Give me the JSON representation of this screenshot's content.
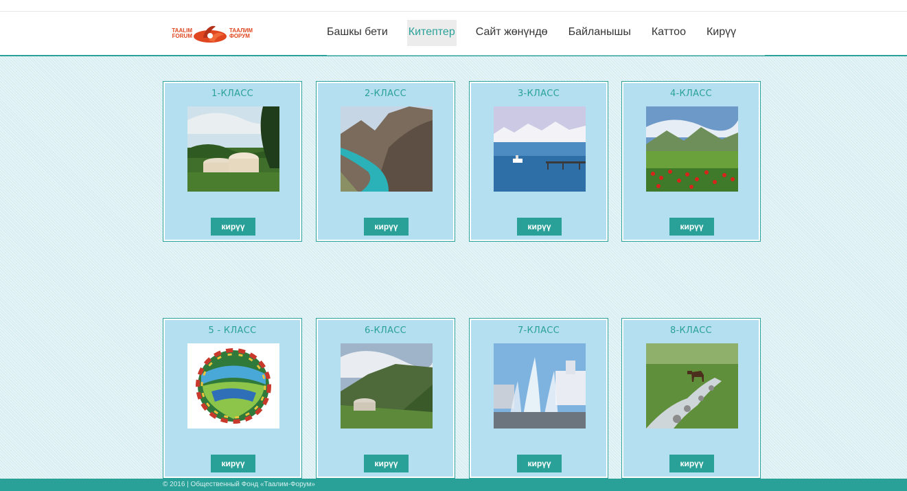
{
  "languages": [
    {
      "code": "kg",
      "icon": "kyrgyz-flag-icon"
    },
    {
      "code": "ru",
      "icon": "russian-flag-icon"
    }
  ],
  "logo": {
    "left_text": [
      "TAALIM",
      "FORUM"
    ],
    "right_text": [
      "ТААЛИМ",
      "ФОРУМ"
    ],
    "colors": {
      "brand": "#e0461f",
      "dark": "#b5321a"
    }
  },
  "nav": {
    "items": [
      {
        "label": "Башкы бети",
        "active": false
      },
      {
        "label": "Китептер",
        "active": true
      },
      {
        "label": "Сайт жөнүндө",
        "active": false
      },
      {
        "label": "Байланышы",
        "active": false
      },
      {
        "label": "Каттоо",
        "active": false
      },
      {
        "label": "Кирүү",
        "active": false
      }
    ]
  },
  "cards": [
    {
      "title": "1-КЛАСС",
      "button": "кирүү",
      "image": "yurts-in-meadow"
    },
    {
      "title": "2-КЛАСС",
      "button": "кирүү",
      "image": "turquoise-river-canyon"
    },
    {
      "title": "3-КЛАСС",
      "button": "кирүү",
      "image": "lake-with-mountains"
    },
    {
      "title": "4-КЛАСС",
      "button": "кирүү",
      "image": "poppy-field-mountains"
    },
    {
      "title": "5 - КЛАСС",
      "button": "кирүү",
      "image": "painted-landscape-circle"
    },
    {
      "title": "6-КЛАСС",
      "button": "кирүү",
      "image": "yurt-in-valley"
    },
    {
      "title": "7-КЛАСС",
      "button": "кирүү",
      "image": "city-fountain"
    },
    {
      "title": "8-КЛАСС",
      "button": "кирүү",
      "image": "horse-by-stream"
    }
  ],
  "footer": {
    "text": "© 2016 | Общественный Фонд «Таалим-Форум»"
  },
  "colors": {
    "accent": "#2aa198",
    "card_bg": "#b3dff0",
    "page_bg": "#d8eef2"
  }
}
